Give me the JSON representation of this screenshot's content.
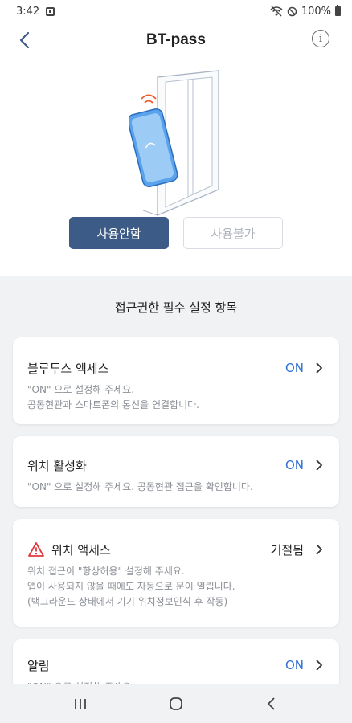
{
  "status_bar": {
    "time": "3:42",
    "battery": "100%"
  },
  "header": {
    "title": "BT-pass",
    "info_label": "i"
  },
  "buttons": {
    "primary": "사용안함",
    "disabled": "사용불가"
  },
  "section_title": "접근권한 필수 설정 항목",
  "cards": [
    {
      "title": "블루투스 액세스",
      "status": "ON",
      "desc": [
        "\"ON\" 으로 설정해 주세요.",
        "공동현관과 스마트폰의 통신을 연결합니다."
      ]
    },
    {
      "title": "위치 활성화",
      "status": "ON",
      "desc": [
        "\"ON\" 으로 설정해 주세요. 공동현관 접근을 확인합니다."
      ]
    },
    {
      "title": "위치 액세스",
      "status": "거절됨",
      "desc": [
        "위치 접근이 \"항상허용\" 설정해 주세요.",
        "앱이 사용되지 않을 때에도 자동으로 문이 열립니다.",
        "(백그라운드 상태에서 기기 위치정보인식 후 작동)"
      ]
    },
    {
      "title": "알림",
      "status": "ON",
      "desc": [
        "\"ON\" 으로 설정해 주세요."
      ]
    }
  ],
  "colors": {
    "accent": "#3d5b87",
    "on": "#2f6fd6",
    "warning": "#e0393e"
  }
}
